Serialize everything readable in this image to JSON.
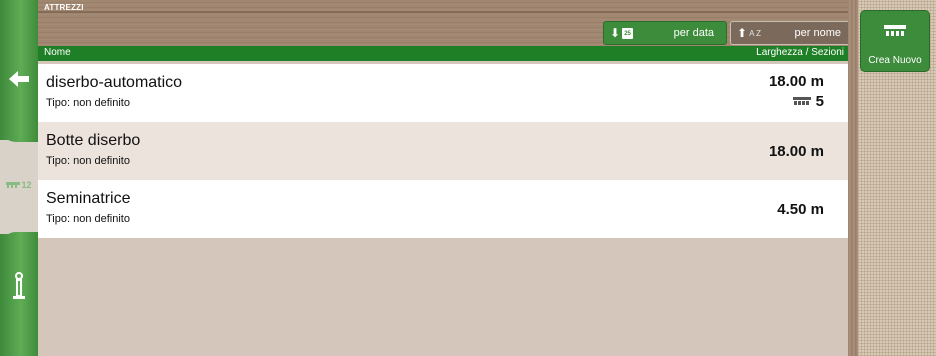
{
  "header": {
    "title": "ATTREZZI"
  },
  "sort": {
    "by_date_label": "per data",
    "by_date_icon_text": "25",
    "by_name_label": "per nome",
    "by_name_icon_text": "A Z"
  },
  "columns": {
    "name": "Nome",
    "width": "Larghezza / Sezioni"
  },
  "implements": [
    {
      "name": "diserbo-automatico",
      "type": "Tipo: non definito",
      "width": "18.00 m",
      "sections": "5"
    },
    {
      "name": "Botte diserbo",
      "type": "Tipo: non definito",
      "width": "18.00 m"
    },
    {
      "name": "Seminatrice",
      "type": "Tipo: non definito",
      "width": "4.50 m"
    }
  ],
  "actions": {
    "new_label": "Crea Nuovo"
  },
  "sidebar": {
    "tool_badge": "12"
  },
  "colors": {
    "primary_green": "#3d8c3b",
    "header_green": "#1f7f27",
    "row_alt": "#ebe3dc"
  }
}
